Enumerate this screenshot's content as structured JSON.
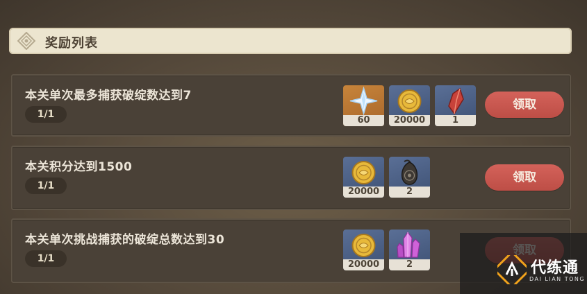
{
  "header": {
    "title": "奖励列表",
    "icon": "diamond-ornament-icon"
  },
  "rows": [
    {
      "description": "本关单次最多捕获破绽数达到7",
      "progress": "1/1",
      "button_label": "领取",
      "rewards": [
        {
          "icon": "primogem-icon",
          "quantity": "60"
        },
        {
          "icon": "mora-coin-icon",
          "quantity": "20000"
        },
        {
          "icon": "red-crystal-shard-icon",
          "quantity": "1"
        }
      ]
    },
    {
      "description": "本关积分达到1500",
      "progress": "1/1",
      "button_label": "领取",
      "rewards": [
        {
          "icon": "mora-coin-icon",
          "quantity": "20000"
        },
        {
          "icon": "dark-pendant-icon",
          "quantity": "2"
        }
      ]
    },
    {
      "description": "本关单次挑战捕获的破绽总数达到30",
      "progress": "1/1",
      "button_label": "领取",
      "rewards": [
        {
          "icon": "mora-coin-icon",
          "quantity": "20000"
        },
        {
          "icon": "pink-crystal-cluster-icon",
          "quantity": "2"
        }
      ]
    }
  ],
  "watermark": {
    "title": "代练通",
    "subtitle": "DAI LIAN TONG",
    "logo_icon": "dlt-logo-icon"
  },
  "colors": {
    "claim_button": "#c9554d",
    "header_bg": "#ece5cf",
    "row_bg": "#4a4137"
  }
}
